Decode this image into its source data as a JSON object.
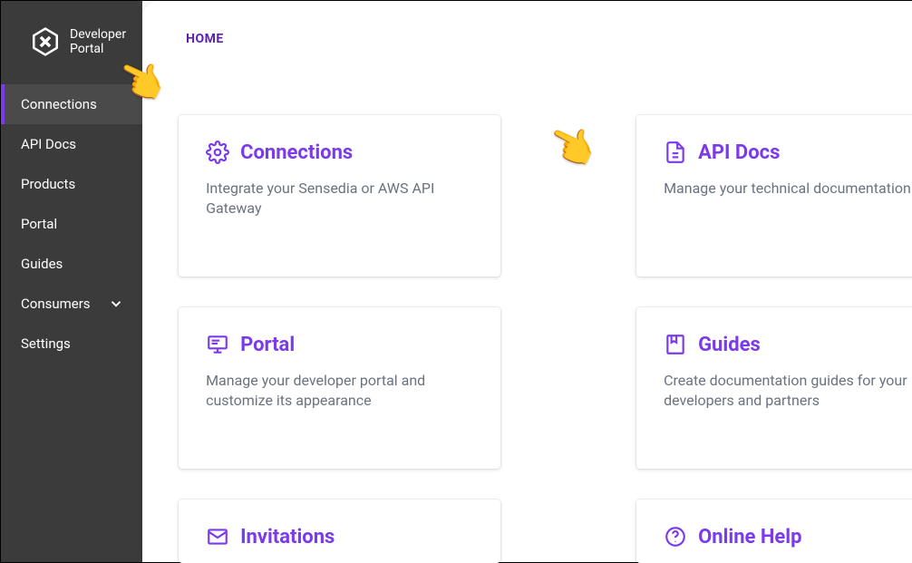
{
  "brand": {
    "line1": "Developer",
    "line2": "Portal"
  },
  "breadcrumb": {
    "home": "HOME"
  },
  "sidebar": {
    "items": [
      {
        "label": "Connections",
        "active": true,
        "expandable": false
      },
      {
        "label": "API Docs",
        "active": false,
        "expandable": false
      },
      {
        "label": "Products",
        "active": false,
        "expandable": false
      },
      {
        "label": "Portal",
        "active": false,
        "expandable": false
      },
      {
        "label": "Guides",
        "active": false,
        "expandable": false
      },
      {
        "label": "Consumers",
        "active": false,
        "expandable": true
      },
      {
        "label": "Settings",
        "active": false,
        "expandable": false
      }
    ]
  },
  "cards": [
    {
      "icon": "gear-icon",
      "title": "Connections",
      "desc": "Integrate your Sensedia or AWS API Gateway"
    },
    {
      "icon": "document-icon",
      "title": "API Docs",
      "desc": "Manage your technical documentation"
    },
    {
      "icon": "display-icon",
      "title": "Portal",
      "desc": "Manage your developer portal and customize its appearance"
    },
    {
      "icon": "bookmark-icon",
      "title": "Guides",
      "desc": "Create documentation guides for your developers and partners"
    },
    {
      "icon": "envelope-icon",
      "title": "Invitations",
      "desc": ""
    },
    {
      "icon": "help-icon",
      "title": "Online Help",
      "desc": ""
    }
  ],
  "colors": {
    "accent": "#7c3aed",
    "sidebar_bg": "#3b3b3b",
    "text_muted": "#6b7280"
  }
}
